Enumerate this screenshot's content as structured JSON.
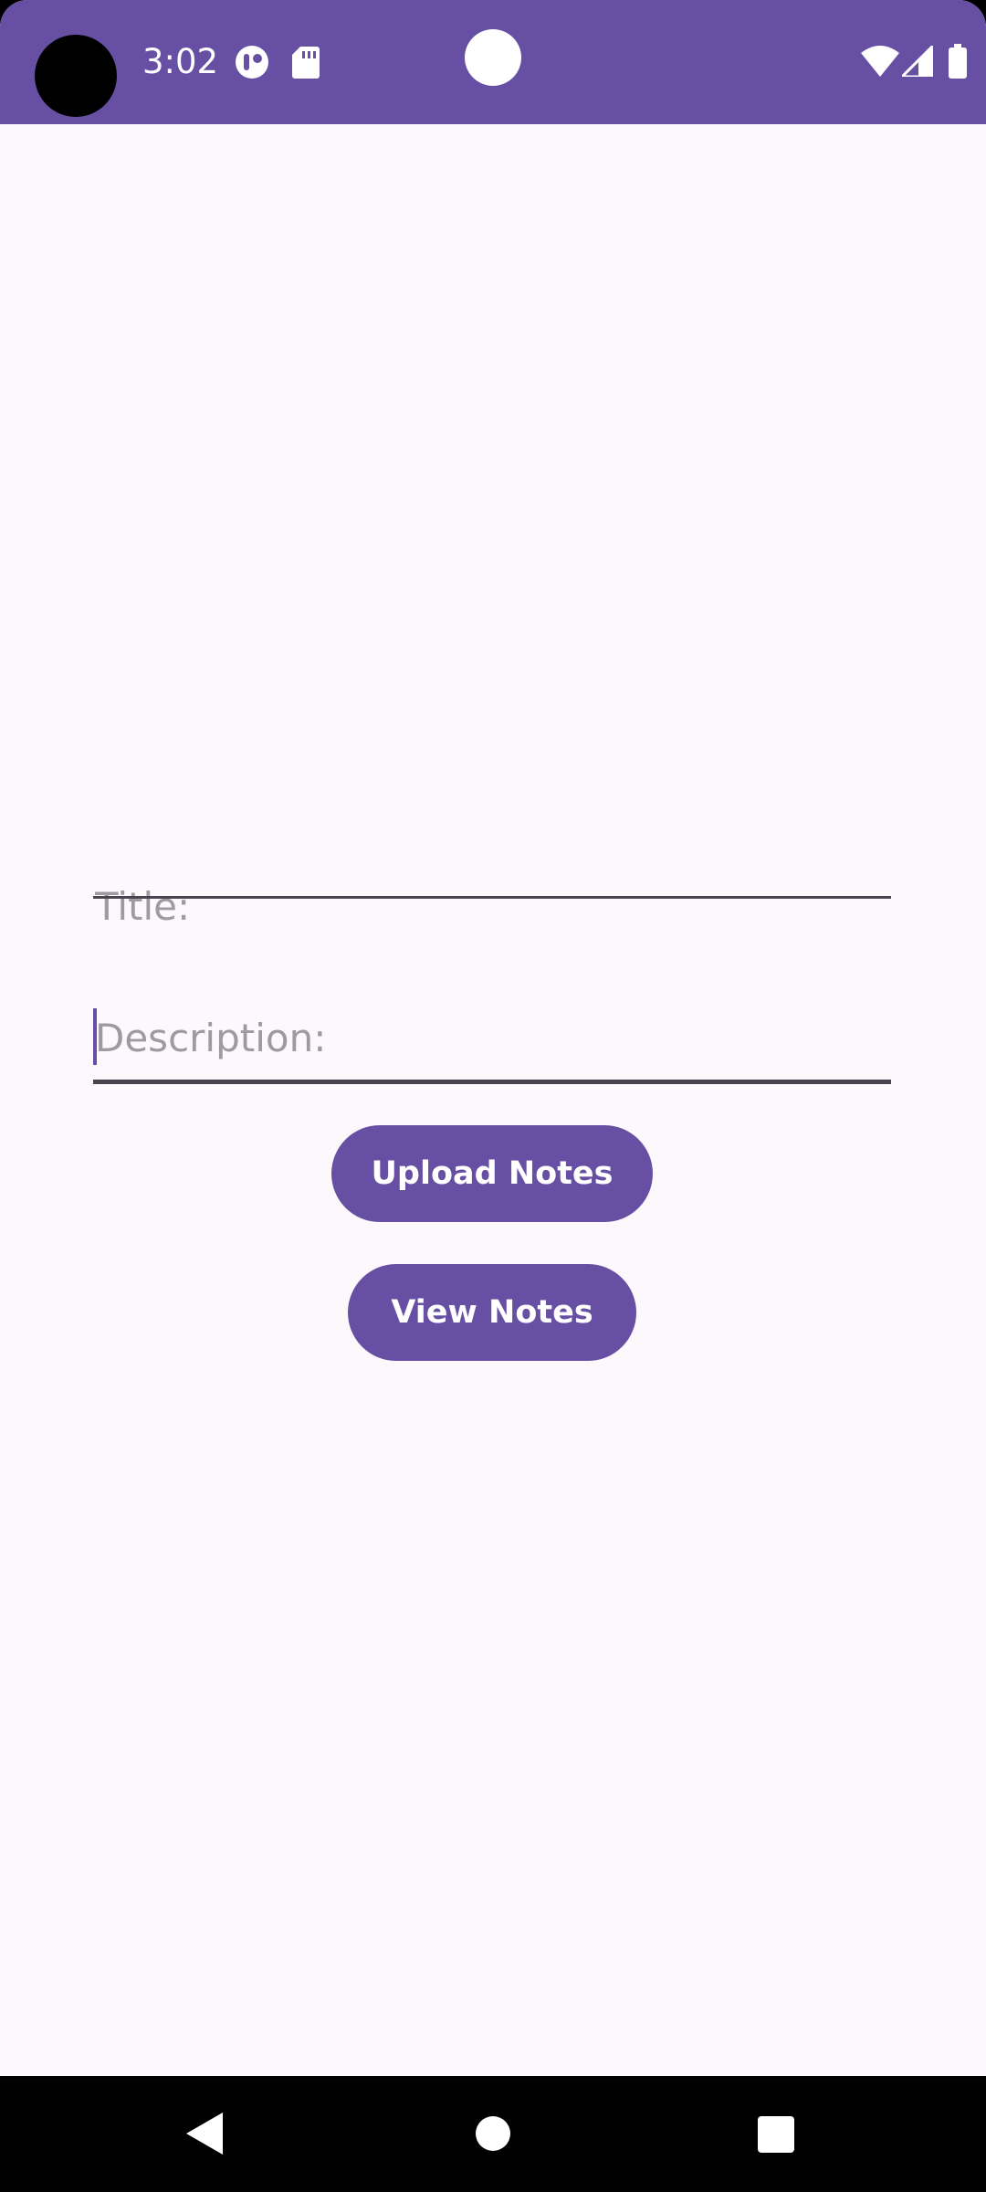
{
  "status_bar": {
    "time": "3:02",
    "left_icons": [
      "media-app-icon",
      "sd-card-icon"
    ],
    "right_icons": [
      "wifi-icon",
      "cell-signal-icon",
      "battery-icon"
    ]
  },
  "form": {
    "title_placeholder": "Title:",
    "title_value": "",
    "description_placeholder": "Description:",
    "description_value": ""
  },
  "actions": {
    "upload_label": "Upload Notes",
    "view_label": "View Notes"
  },
  "nav_bar": {
    "buttons": [
      "back-icon",
      "home-icon",
      "recents-icon"
    ]
  },
  "colors": {
    "primary": "#6750a4",
    "background": "#fdf8fc",
    "on_primary": "#ffffff"
  }
}
